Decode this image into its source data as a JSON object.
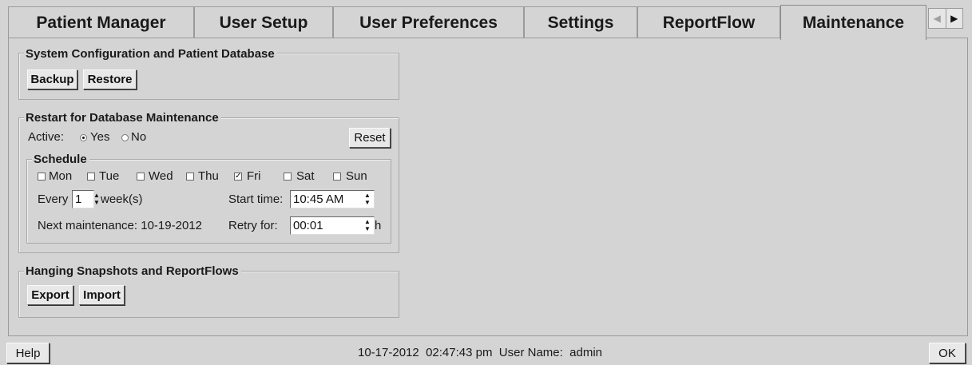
{
  "tabs": [
    {
      "label": "Patient Manager"
    },
    {
      "label": "User Setup"
    },
    {
      "label": "User Preferences"
    },
    {
      "label": "Settings"
    },
    {
      "label": "ReportFlow"
    },
    {
      "label": "Maintenance",
      "active": true
    }
  ],
  "tab_scroll": {
    "left": "◀",
    "right": "▶"
  },
  "system_config": {
    "title": "System Configuration and Patient Database",
    "backup_label": "Backup",
    "restore_label": "Restore"
  },
  "restart": {
    "title": "Restart for Database Maintenance",
    "active_label": "Active:",
    "yes_label": "Yes",
    "no_label": "No",
    "active_value": "Yes",
    "reset_label": "Reset",
    "schedule": {
      "title": "Schedule",
      "days": [
        {
          "label": "Mon",
          "checked": false
        },
        {
          "label": "Tue",
          "checked": false
        },
        {
          "label": "Wed",
          "checked": false
        },
        {
          "label": "Thu",
          "checked": false
        },
        {
          "label": "Fri",
          "checked": true
        },
        {
          "label": "Sat",
          "checked": false
        },
        {
          "label": "Sun",
          "checked": false
        }
      ],
      "every_label": "Every",
      "every_value": "1",
      "every_unit": "week(s)",
      "start_time_label": "Start time:",
      "start_time_value": "10:45 AM",
      "next_label": "Next maintenance: 10-19-2012",
      "retry_label": "Retry for:",
      "retry_value": "00:01",
      "retry_unit": "h"
    }
  },
  "hanging": {
    "title": "Hanging Snapshots and ReportFlows",
    "export_label": "Export",
    "import_label": "Import"
  },
  "statusbar": {
    "help_label": "Help",
    "status_text": "10-17-2012  02:47:43 pm  User Name:  admin",
    "ok_label": "OK"
  },
  "icons": {
    "radio_on": "radio-selected",
    "check_on": "check-mark",
    "spin": "spin-up-down"
  },
  "colors": {
    "background": "#d4d4d4",
    "field": "#ffffff"
  }
}
